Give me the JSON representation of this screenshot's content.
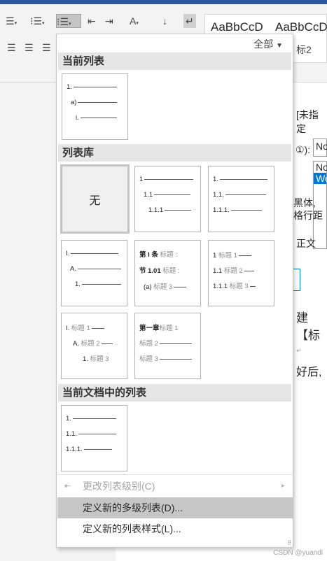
{
  "ribbon": {
    "row1_icons": [
      "bullets-icon",
      "numbering-icon",
      "multilevel-list-icon",
      "decrease-indent-icon",
      "increase-indent-icon",
      "chinese-layout-icon",
      "sort-icon",
      "show-marks-icon"
    ],
    "row2_icons": [
      "align-left-icon",
      "align-center-icon",
      "align-right-icon"
    ],
    "style_samples": [
      "AaBbCcD",
      "AaBbCcD"
    ],
    "style_name_visible": "标2"
  },
  "document": {
    "fragments": [
      "[未指定",
      "①):",
      "No",
      "No",
      "We",
      "黑体,",
      "格行距",
      "正文",
      "建【标",
      "↵",
      "好后,"
    ]
  },
  "menu": {
    "filter_label": "全部",
    "sections": {
      "current_list": "当前列表",
      "library": "列表库",
      "document_lists": "当前文档中的列表"
    },
    "current_list_tile": [
      "1.",
      "a)",
      "i."
    ],
    "library_tiles": {
      "none_label": "无",
      "t2": [
        "1",
        "1.1",
        "1.1.1"
      ],
      "t3": [
        "1.",
        "1.1.",
        "1.1.1."
      ],
      "t4": [
        "I.",
        "A.",
        "1."
      ],
      "t5": [
        {
          "num": "第 I 条",
          "text": "标题 :"
        },
        {
          "num": "节 1.01",
          "text": "标题 :"
        },
        {
          "num": "(a)",
          "text": "标题 3"
        }
      ],
      "t6": [
        {
          "num": "1",
          "text": "标题 1"
        },
        {
          "num": "1.1",
          "text": "标题 2"
        },
        {
          "num": "1.1.1",
          "text": "标题 3"
        }
      ],
      "t7": [
        {
          "num": "I.",
          "text": "标题 1"
        },
        {
          "num": "A.",
          "text": "标题 2"
        },
        {
          "num": "1.",
          "text": "标题 3"
        }
      ],
      "t8": [
        {
          "num": "第一章",
          "text": "标题 1"
        },
        {
          "num": "",
          "text": "标题 2"
        },
        {
          "num": "",
          "text": "标题 3"
        }
      ]
    },
    "doc_list_tile": [
      "1.",
      "1.1.",
      "1.1.1."
    ],
    "items": {
      "change_level": "更改列表级别(C)",
      "define_multilevel": "定义新的多级列表(D)...",
      "define_style": "定义新的列表样式(L)..."
    }
  },
  "watermark": "CSDN @yuandl"
}
